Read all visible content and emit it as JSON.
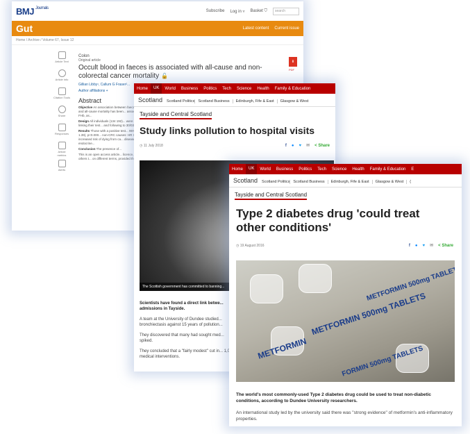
{
  "bmj": {
    "logo": "BMJ",
    "logo_sub": "Journals",
    "top_links": [
      "Subscribe",
      "Log in",
      "Basket"
    ],
    "search_placeholder": "search",
    "journal": "Gut",
    "bar_links": [
      "Latest content",
      "Current issue"
    ],
    "breadcrumb": "Home / Archive / Volume 67, Issue 12",
    "tools": [
      "Article Text",
      "Article info",
      "Citation Tools",
      "Share",
      "Responses",
      "Article metrics",
      "Alerts"
    ],
    "section": "Colon",
    "article_type": "Original article",
    "title": "Occult blood in faeces is associated with all-cause and non-colorectal cancer mortality",
    "authors": "Gillian Libby¹, Callum G Fraser²...",
    "affiliations": "Author affiliations +",
    "abstract_heading": "Abstract",
    "abstract": [
      {
        "label": "Objective",
        "text": "An association between faecal haemoglobin and all-cause mortality has been... association between FHb, as..."
      },
      {
        "label": "Design",
        "text": "All individuals (134 192)... were studied by linking their test... and following to 30/03/2016..."
      },
      {
        "label": "Results",
        "text": "Those with a positive test... 95% CI 1.13 to 1.39), p<0.000... non-CRC causes: HR 1.58 95%... increased risk of dying from ca... disease, blood and endocrine..."
      },
      {
        "label": "Conclusion",
        "text": "The presence of..."
      },
      {
        "label": "",
        "text": "This is an open access article... licence, which permits others t... on different terms, provided th..."
      }
    ],
    "pdf_label": "PDF"
  },
  "bbc1": {
    "nav": [
      "Home",
      "UK",
      "World",
      "Business",
      "Politics",
      "Tech",
      "Science",
      "Health",
      "Family & Education"
    ],
    "nav_active": "UK",
    "scotland": "Scotland",
    "sub_items": [
      "Scotland Politics",
      "Scotland Business",
      "Edinburgh, Fife & East",
      "Glasgow & West"
    ],
    "region": "Tayside and Central Scotland",
    "headline": "Study links pollution to hospital visits",
    "date": "11 July 2018",
    "share_label": "Share",
    "caption": "The Scottish government has committed to banning...",
    "paragraphs": [
      "Scientists have found a direct link betwe... admissions in Tayside.",
      "A team at the University of Dundee studied... bronchiectasis against 15 years of pollution...",
      "They discovered that many had sought med... spiked.",
      "They concluded that a \"fairly modest\" cut in... 1,000 medical interventions."
    ]
  },
  "bbc2": {
    "nav": [
      "Home",
      "UK",
      "World",
      "Business",
      "Politics",
      "Tech",
      "Science",
      "Health",
      "Family & Education",
      "E"
    ],
    "nav_active": "UK",
    "scotland": "Scotland",
    "sub_items": [
      "Scotland Politics",
      "Scotland Business",
      "Edinburgh, Fife & East",
      "Glasgow & West",
      "("
    ],
    "region": "Tayside and Central Scotland",
    "headline": "Type 2 diabetes drug 'could treat other conditions'",
    "date": "19 August 2016",
    "share_label": "Share",
    "paragraphs": [
      "The world's most commonly-used Type 2 diabetes drug could be used to treat non-diabetic conditions, according to Dundee University researchers.",
      "An international study led by the university said there was \"strong evidence\" of metformin's anti-inflammatory properties."
    ],
    "pill_texts": [
      "METFORMIN 500mg TABLETS",
      "METFORMIN 500mg TABLETS",
      "METFORMIN",
      "FORMIN 500mg TABLETS"
    ]
  },
  "colors": {
    "bmj_orange": "#e88a10",
    "bbc_red": "#b80000",
    "bmj_blue": "#1a3f8a"
  }
}
